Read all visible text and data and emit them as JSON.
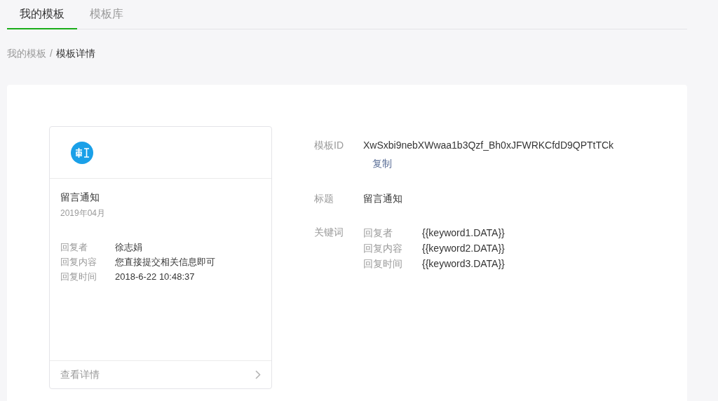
{
  "tabs": [
    {
      "label": "我的模板",
      "selected": true
    },
    {
      "label": "模板库",
      "selected": false
    }
  ],
  "breadcrumb": {
    "parent": "我的模板",
    "separator": "/",
    "current": "模板详情"
  },
  "card": {
    "title": "留言通知",
    "date": "2019年04月",
    "fields": [
      {
        "label": "回复者",
        "value": "徐志娟"
      },
      {
        "label": "回复内容",
        "value": "您直接提交相关信息即可"
      },
      {
        "label": "回复时间",
        "value": "2018-6-22 10:48:37"
      }
    ],
    "footer_link": "查看详情"
  },
  "details": {
    "id_label": "模板ID",
    "id_value": "XwSxbi9nebXWwaa1b3Qzf_Bh0xJFWRKCfdD9QPTtTCk",
    "copy": "复制",
    "title_label": "标题",
    "title_value": "留言通知",
    "keywords_label": "关键词",
    "keywords": [
      {
        "name": "回复者",
        "value": "{{keyword1.DATA}}"
      },
      {
        "name": "回复内容",
        "value": "{{keyword2.DATA}}"
      },
      {
        "name": "回复时间",
        "value": "{{keyword3.DATA}}"
      }
    ]
  }
}
